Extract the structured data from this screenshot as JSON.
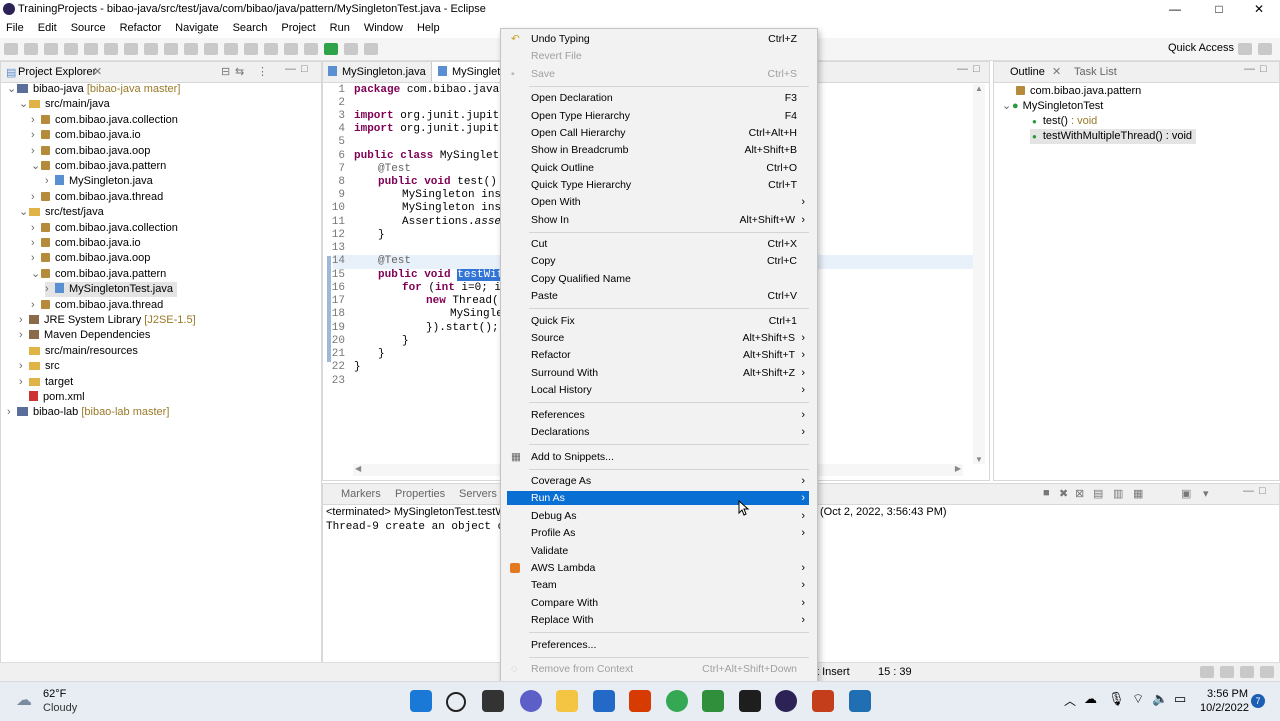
{
  "window": {
    "title": "TrainingProjects - bibao-java/src/test/java/com/bibao/java/pattern/MySingletonTest.java - Eclipse",
    "controls": {
      "minimize": "—",
      "maximize": "□",
      "close": "✕"
    }
  },
  "menubar": [
    "File",
    "Edit",
    "Source",
    "Refactor",
    "Navigate",
    "Search",
    "Project",
    "Run",
    "Window",
    "Help"
  ],
  "toolbar": {
    "quick_access": "Quick Access"
  },
  "project_explorer": {
    "title": "Project Explorer",
    "items": [
      {
        "label": "bibao-java",
        "dec": "[bibao-java master]"
      },
      {
        "label": "src/main/java",
        "dec": ""
      },
      {
        "label": "com.bibao.java.collection",
        "dec": ""
      },
      {
        "label": "com.bibao.java.io",
        "dec": ""
      },
      {
        "label": "com.bibao.java.oop",
        "dec": ""
      },
      {
        "label": "com.bibao.java.pattern",
        "dec": ""
      },
      {
        "label": "MySingleton.java",
        "dec": ""
      },
      {
        "label": "com.bibao.java.thread",
        "dec": ""
      },
      {
        "label": "src/test/java",
        "dec": ""
      },
      {
        "label": "com.bibao.java.collection",
        "dec": ""
      },
      {
        "label": "com.bibao.java.io",
        "dec": ""
      },
      {
        "label": "com.bibao.java.oop",
        "dec": ""
      },
      {
        "label": "com.bibao.java.pattern",
        "dec": ""
      },
      {
        "label": "MySingletonTest.java",
        "dec": ""
      },
      {
        "label": "com.bibao.java.thread",
        "dec": ""
      },
      {
        "label": "JRE System Library",
        "dec": "[J2SE-1.5]"
      },
      {
        "label": "Maven Dependencies",
        "dec": ""
      },
      {
        "label": "src/main/resources",
        "dec": ""
      },
      {
        "label": "src",
        "dec": ""
      },
      {
        "label": "target",
        "dec": ""
      },
      {
        "label": "pom.xml",
        "dec": ""
      },
      {
        "label": "bibao-lab",
        "dec": "[bibao-lab master]"
      }
    ]
  },
  "editor": {
    "tabs": [
      "MySingleton.java",
      "MySingletonTest.java"
    ],
    "line_numbers": [
      "1",
      "2",
      "3",
      "4",
      "5",
      "6",
      "7",
      "8",
      "9",
      "10",
      "11",
      "12",
      "13",
      "14",
      "15",
      "16",
      "17",
      "18",
      "19",
      "20",
      "21",
      "22",
      "23"
    ],
    "lines": {
      "l1_kw": "package",
      "l1_rest": " com.bibao.java.pa",
      "l3_kw": "import",
      "l3_rest": " org.junit.jupiter.",
      "l4_kw": "import",
      "l4_rest": " org.junit.jupiter.",
      "l6_kw": "public class",
      "l6_rest": " MySingletonT",
      "l7": "@Test",
      "l8_kw": "public void",
      "l8_rest": " test() {",
      "l9": "MySingleton insta",
      "l10": "MySingleton insta",
      "l11_a": "Assertions.",
      "l11_b": "assert",
      "l12": "}",
      "l14": "@Test",
      "l15_kw": "public void",
      "l15_sel": "testWithM",
      "l16_kw": "for",
      "l16_a": " (",
      "l16_kw2": "int",
      "l16_b": " i=0; i<1",
      "l17_kw": "new",
      "l17_rest": " Thread(()",
      "l18": "MySinglet",
      "l19": "}).start();",
      "l20": "}",
      "l21": "}",
      "l22": "}"
    }
  },
  "outline": {
    "tabs": [
      "Outline",
      "Task List"
    ],
    "package": "com.bibao.java.pattern",
    "class": "MySingletonTest",
    "methods": [
      {
        "name": "test()",
        "type": " : void"
      },
      {
        "name": "testWithMultipleThread()",
        "type": " : void"
      }
    ]
  },
  "console": {
    "tabs": [
      "Markers",
      "Properties",
      "Servers"
    ],
    "terminated": "<terminated> MySingletonTest.testWith",
    "timestamp": "(Oct 2, 2022, 3:56:43 PM)",
    "output": "Thread-9 create an object of"
  },
  "status": {
    "insert_mode": "t Insert",
    "position": "15 : 39"
  },
  "context_menu": [
    {
      "label": "Undo Typing",
      "shortcut": "Ctrl+Z",
      "icon": "undo-icon"
    },
    {
      "label": "Revert File",
      "shortcut": "",
      "disabled": true
    },
    {
      "label": "Save",
      "shortcut": "Ctrl+S",
      "disabled": true
    },
    {
      "label": "Open Declaration",
      "shortcut": "F3"
    },
    {
      "label": "Open Type Hierarchy",
      "shortcut": "F4"
    },
    {
      "label": "Open Call Hierarchy",
      "shortcut": "Ctrl+Alt+H"
    },
    {
      "label": "Show in Breadcrumb",
      "shortcut": "Alt+Shift+B"
    },
    {
      "label": "Quick Outline",
      "shortcut": "Ctrl+O"
    },
    {
      "label": "Quick Type Hierarchy",
      "shortcut": "Ctrl+T"
    },
    {
      "label": "Open With",
      "submenu": true
    },
    {
      "label": "Show In",
      "shortcut": "Alt+Shift+W",
      "submenu": true
    },
    {
      "label": "Cut",
      "shortcut": "Ctrl+X"
    },
    {
      "label": "Copy",
      "shortcut": "Ctrl+C"
    },
    {
      "label": "Copy Qualified Name",
      "shortcut": ""
    },
    {
      "label": "Paste",
      "shortcut": "Ctrl+V"
    },
    {
      "label": "Quick Fix",
      "shortcut": "Ctrl+1"
    },
    {
      "label": "Source",
      "shortcut": "Alt+Shift+S",
      "submenu": true
    },
    {
      "label": "Refactor",
      "shortcut": "Alt+Shift+T",
      "submenu": true
    },
    {
      "label": "Surround With",
      "shortcut": "Alt+Shift+Z",
      "submenu": true
    },
    {
      "label": "Local History",
      "submenu": true
    },
    {
      "label": "References",
      "submenu": true
    },
    {
      "label": "Declarations",
      "submenu": true
    },
    {
      "label": "Add to Snippets...",
      "icon": "snippet-icon"
    },
    {
      "label": "Coverage As",
      "submenu": true
    },
    {
      "label": "Run As",
      "submenu": true,
      "highlighted": true
    },
    {
      "label": "Debug As",
      "submenu": true
    },
    {
      "label": "Profile As",
      "submenu": true
    },
    {
      "label": "Validate"
    },
    {
      "label": "AWS Lambda",
      "submenu": true,
      "icon": "aws-icon"
    },
    {
      "label": "Team",
      "submenu": true
    },
    {
      "label": "Compare With",
      "submenu": true
    },
    {
      "label": "Replace With",
      "submenu": true
    },
    {
      "label": "Preferences..."
    },
    {
      "label": "Remove from Context",
      "shortcut": "Ctrl+Alt+Shift+Down",
      "disabled": true
    }
  ],
  "taskbar": {
    "weather_temp": "62°F",
    "weather_desc": "Cloudy",
    "time": "3:56 PM",
    "date": "10/2/2022",
    "notification_count": "7"
  },
  "colors": {
    "highlight": "#0a6fd3",
    "keyword": "#7f0055",
    "selection": "#3375d6"
  }
}
